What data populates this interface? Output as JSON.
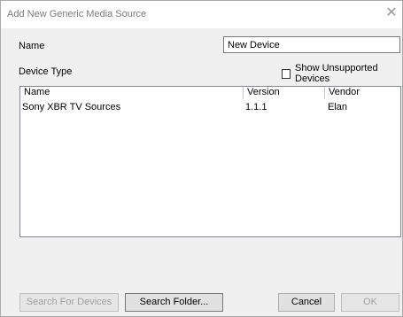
{
  "window": {
    "title": "Add New Generic Media Source",
    "close_glyph": "✕"
  },
  "form": {
    "name_label": "Name",
    "name_value": "New Device",
    "device_type_label": "Device Type",
    "show_unsupported_label": "Show Unsupported Devices",
    "show_unsupported_checked": false
  },
  "list": {
    "columns": [
      "Name",
      "Version",
      "Vendor"
    ],
    "rows": [
      {
        "name": "Sony XBR TV Sources",
        "version": "1.1.1",
        "vendor": "Elan"
      }
    ]
  },
  "buttons": {
    "search_devices": "Search For Devices",
    "search_folder": "Search Folder...",
    "cancel": "Cancel",
    "ok": "OK"
  },
  "icons": {
    "close": "close-icon",
    "checkbox": "checkbox-icon"
  }
}
